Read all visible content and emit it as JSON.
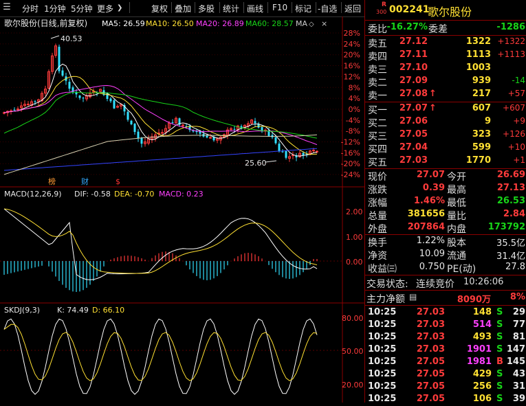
{
  "toolbar": {
    "items": [
      "分时",
      "1分钟",
      "5分钟",
      "更多",
      "复权",
      "叠加",
      "多股",
      "统计",
      "画线",
      "F10",
      "标记",
      "-自选",
      "返回"
    ]
  },
  "main_chart": {
    "title": "歌尔股份(日线,前复权)",
    "ma": [
      {
        "label": "MA5: 26.59",
        "color": "#ffffff"
      },
      {
        "label": "MA10: 26.50",
        "color": "#ffe033"
      },
      {
        "label": "MA20: 26.89",
        "color": "#ff40ff"
      },
      {
        "label": "MA60: 28.57",
        "color": "#18d418"
      },
      {
        "label": "MA",
        "color": "#cccccc"
      }
    ],
    "high_label": "40.53",
    "low_label": "25.60",
    "pct_ticks": [
      "28%",
      "24%",
      "20%",
      "16%",
      "12%",
      "8%",
      "4%",
      "0%",
      "-4%",
      "-8%",
      "-12%",
      "-16%",
      "-20%",
      "-24%"
    ],
    "markers": [
      "榜",
      "财",
      "$"
    ]
  },
  "macd_panel": {
    "title": "MACD(12,26,9)",
    "dif": "DIF: -0.58",
    "dea": "DEA: -0.70",
    "macd": "MACD: 0.23",
    "ticks": [
      "2.00",
      "1.00",
      "0.00"
    ]
  },
  "skdj_panel": {
    "title": "SKDJ(9,3)",
    "k": "K: 74.49",
    "d": "D: 66.10",
    "ticks": [
      "80.00",
      "50.00",
      "20.00"
    ]
  },
  "stock": {
    "market_badge": "R",
    "market_sub": "300",
    "code": "002241",
    "name": "歌尔股份"
  },
  "weibi": {
    "l1": "委比",
    "v1": "-16.27%",
    "l2": "委差",
    "v2": "-1286"
  },
  "asks": [
    {
      "label": "卖五",
      "price": "27.12",
      "vol": "1322",
      "chg": "+1322"
    },
    {
      "label": "卖四",
      "price": "27.11",
      "vol": "1113",
      "chg": "+1113"
    },
    {
      "label": "卖三",
      "price": "27.10",
      "vol": "1003",
      "chg": ""
    },
    {
      "label": "卖二",
      "price": "27.09",
      "vol": "939",
      "chg": "-14"
    },
    {
      "label": "卖一",
      "price": "27.08",
      "vol": "217",
      "chg": "+57",
      "arrow": "↑"
    }
  ],
  "bids": [
    {
      "label": "买一",
      "price": "27.07",
      "vol": "607",
      "chg": "+607",
      "arrow": "↑"
    },
    {
      "label": "买二",
      "price": "27.06",
      "vol": "9",
      "chg": "+9"
    },
    {
      "label": "买三",
      "price": "27.05",
      "vol": "323",
      "chg": "+126"
    },
    {
      "label": "买四",
      "price": "27.04",
      "vol": "599",
      "chg": "+10"
    },
    {
      "label": "买五",
      "price": "27.03",
      "vol": "1770",
      "chg": "+1"
    }
  ],
  "quote": [
    {
      "l1": "现价",
      "v1": "27.07",
      "c1": "red",
      "l2": "今开",
      "v2": "26.69",
      "c2": "red"
    },
    {
      "l1": "涨跌",
      "v1": "0.39",
      "c1": "red",
      "l2": "最高",
      "v2": "27.13",
      "c2": "red"
    },
    {
      "l1": "涨幅",
      "v1": "1.46%",
      "c1": "red",
      "l2": "最低",
      "v2": "26.53",
      "c2": "green"
    },
    {
      "l1": "总量",
      "v1": "381656",
      "c1": "yel",
      "l2": "量比",
      "v2": "2.84",
      "c2": "red"
    },
    {
      "l1": "外盘",
      "v1": "207864",
      "c1": "red",
      "l2": "内盘",
      "v2": "173792",
      "c2": "green"
    }
  ],
  "finance": [
    {
      "l1": "换手",
      "v1": "1.22%",
      "l2": "股本",
      "v2": "35.5亿"
    },
    {
      "l1": "净资",
      "v1": "10.09",
      "l2": "流通",
      "v2": "31.4亿"
    },
    {
      "l1": "收益㈢",
      "v1": "0.750",
      "l2": "PE(动)",
      "v2": "27.8"
    }
  ],
  "trade_status": {
    "label": "交易状态:",
    "status": "连续竞价",
    "time": "10:26:06"
  },
  "net_flow": {
    "label": "主力净额",
    "value": "8090万",
    "pct": "8%"
  },
  "ticks": [
    {
      "time": "10:25",
      "price": "27.03",
      "vol": "148",
      "side": "S",
      "n": "29"
    },
    {
      "time": "10:25",
      "price": "27.03",
      "vol": "514",
      "side": "S",
      "n": "77"
    },
    {
      "time": "10:25",
      "price": "27.03",
      "vol": "493",
      "side": "S",
      "n": "81"
    },
    {
      "time": "10:25",
      "price": "27.03",
      "vol": "1901",
      "side": "S",
      "n": "147"
    },
    {
      "time": "10:25",
      "price": "27.05",
      "vol": "1981",
      "side": "B",
      "n": "145"
    },
    {
      "time": "10:25",
      "price": "27.05",
      "vol": "429",
      "side": "S",
      "n": "43"
    },
    {
      "time": "10:25",
      "price": "27.05",
      "vol": "256",
      "side": "S",
      "n": "31"
    },
    {
      "time": "10:25",
      "price": "27.05",
      "vol": "106",
      "side": "S",
      "n": "39"
    }
  ],
  "colors": {
    "up": "#ff3b3b",
    "down": "#18d418",
    "grid": "#8b0000",
    "vol": "#ffe033"
  }
}
